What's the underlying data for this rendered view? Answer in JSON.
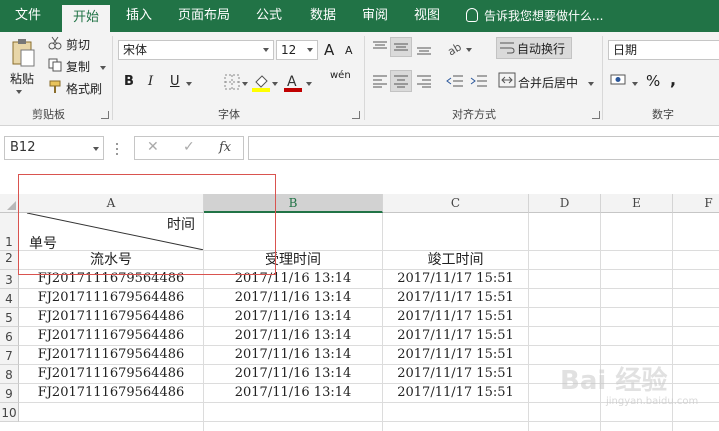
{
  "tabs": {
    "file": "文件",
    "home": "开始",
    "insert": "插入",
    "page_layout": "页面布局",
    "formulas": "公式",
    "data": "数据",
    "review": "审阅",
    "view": "视图",
    "tell_me": "告诉我您想要做什么..."
  },
  "clipboard": {
    "paste": "粘贴",
    "cut": "剪切",
    "copy": "复制",
    "format_painter": "格式刷",
    "label": "剪贴板"
  },
  "font": {
    "name": "宋体",
    "size": "12",
    "bold": "B",
    "italic": "I",
    "underline": "U",
    "grow": "A",
    "shrink": "A",
    "wen": "wén",
    "label": "字体",
    "fill_color": "#ffff00",
    "font_color": "#c00000"
  },
  "alignment": {
    "wrap_text": "自动换行",
    "merge_center": "合并后居中",
    "label": "对齐方式"
  },
  "number": {
    "format": "日期",
    "percent": "%",
    "comma": ",",
    "label": "数字"
  },
  "formula_bar": {
    "name_box": "B12",
    "cancel": "✕",
    "enter": "✓",
    "fx": "fx",
    "value": ""
  },
  "grid": {
    "columns": [
      "A",
      "B",
      "C",
      "D",
      "E",
      "F"
    ],
    "rows": [
      "1",
      "2",
      "3",
      "4",
      "5",
      "6",
      "7",
      "8",
      "9",
      "10"
    ],
    "header_top_right": "时间",
    "header_bottom_left": "单号",
    "row2": [
      "流水号",
      "受理时间",
      "竣工时间"
    ],
    "data": [
      [
        "FJ2017111679564486",
        "2017/11/16 13:14",
        "2017/11/17 15:51"
      ],
      [
        "FJ2017111679564486",
        "2017/11/16 13:14",
        "2017/11/17 15:51"
      ],
      [
        "FJ2017111679564486",
        "2017/11/16 13:14",
        "2017/11/17 15:51"
      ],
      [
        "FJ2017111679564486",
        "2017/11/16 13:14",
        "2017/11/17 15:51"
      ],
      [
        "FJ2017111679564486",
        "2017/11/16 13:14",
        "2017/11/17 15:51"
      ],
      [
        "FJ2017111679564486",
        "2017/11/16 13:14",
        "2017/11/17 15:51"
      ],
      [
        "FJ2017111679564486",
        "2017/11/16 13:14",
        "2017/11/17 15:51"
      ]
    ]
  },
  "watermark": {
    "main": "Bai 经验",
    "sub": "jingyan.baidu.com"
  },
  "colors": {
    "accent": "#217346",
    "highlight_box": "#d9534f"
  }
}
